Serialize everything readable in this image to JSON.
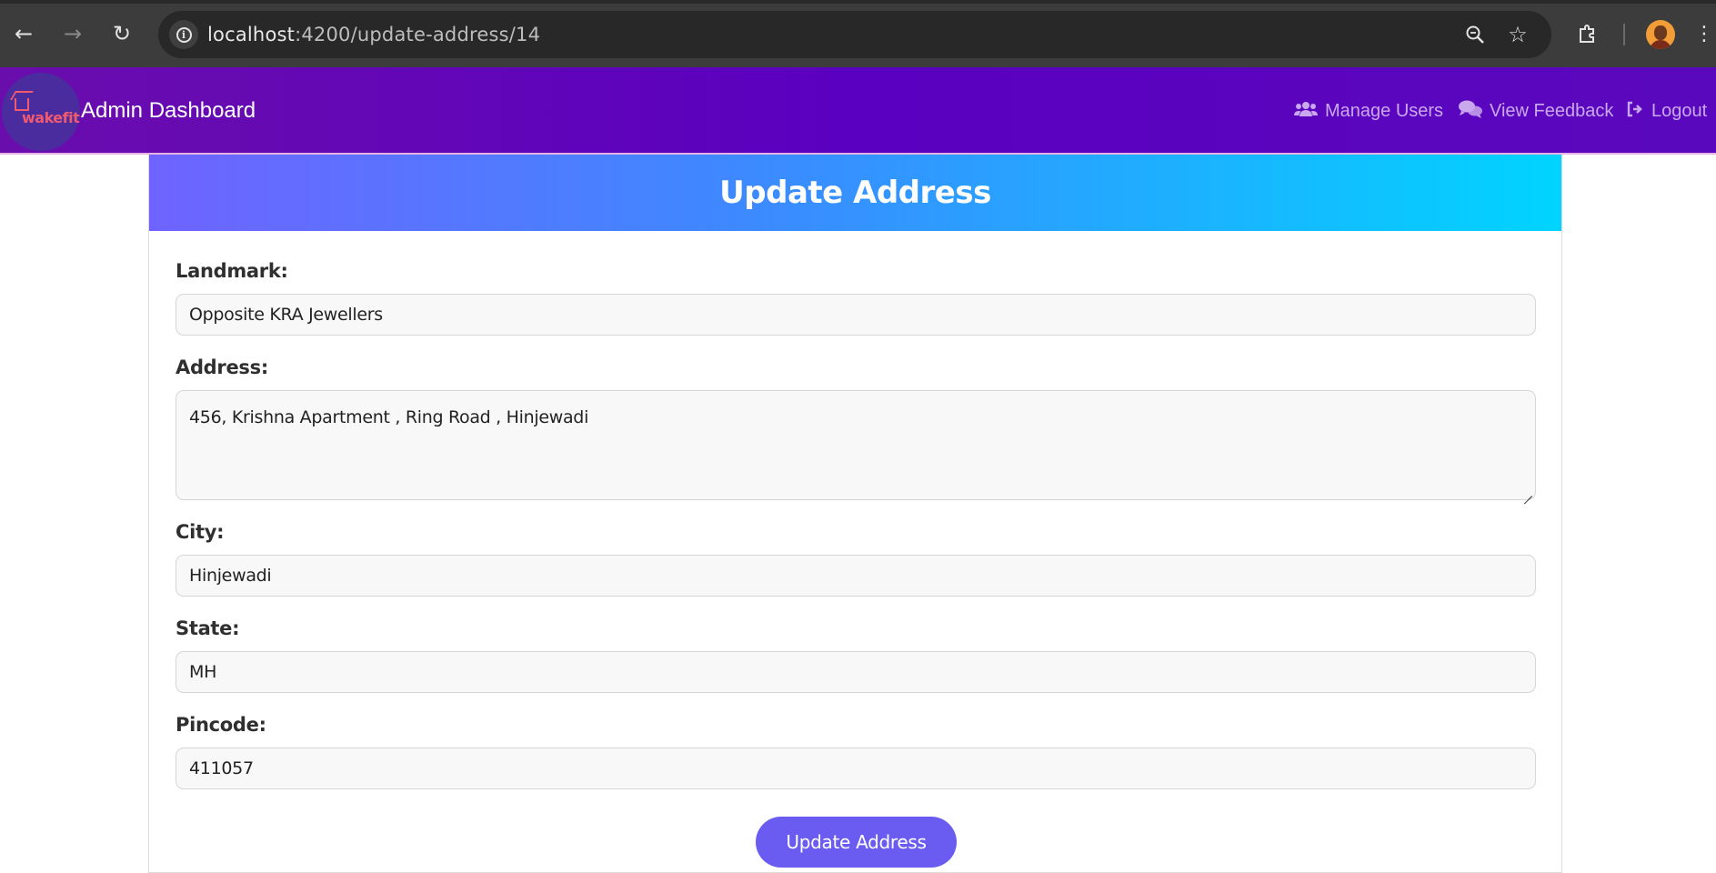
{
  "browser": {
    "url_host": "localhost",
    "url_path": ":4200/update-address/14",
    "icons": {
      "back": "back-arrow-icon",
      "forward": "forward-arrow-icon",
      "reload": "reload-icon",
      "info": "site-info-icon",
      "zoom": "zoom-icon",
      "bookmark": "star-icon",
      "extensions": "puzzle-icon",
      "profile": "avatar",
      "menu": "kebab-menu-icon"
    }
  },
  "navbar": {
    "logo_text": "wakefit",
    "title": "Admin Dashboard",
    "links": [
      {
        "label": "Manage Users",
        "icon": "users-icon"
      },
      {
        "label": "View Feedback",
        "icon": "comments-icon"
      },
      {
        "label": "Logout",
        "icon": "logout-icon"
      }
    ],
    "colors": {
      "background": "#5a00c0",
      "link": "#c9a8ee"
    }
  },
  "form": {
    "heading": "Update Address",
    "fields": {
      "landmark": {
        "label": "Landmark:",
        "value": "Opposite KRA Jewellers"
      },
      "address": {
        "label": "Address:",
        "value": "456, Krishna Apartment , Ring Road , Hinjewadi"
      },
      "city": {
        "label": "City:",
        "value": "Hinjewadi"
      },
      "state": {
        "label": "State:",
        "value": "MH"
      },
      "pincode": {
        "label": "Pincode:",
        "value": "411057"
      }
    },
    "submit_label": "Update Address",
    "colors": {
      "header_start": "#6f63ff",
      "header_end": "#00d4ff",
      "button": "#6a5cf0"
    }
  }
}
